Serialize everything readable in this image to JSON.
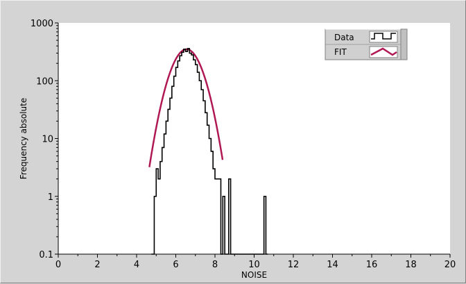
{
  "chart_data": {
    "type": "line",
    "title": "",
    "xlabel": "NOISE",
    "ylabel": "Frequency absolute",
    "xlim": [
      0,
      20
    ],
    "ylim": [
      0.1,
      1000
    ],
    "yscale": "log",
    "grid": false,
    "legend_position": "top-right",
    "x_ticks": [
      "0",
      "2",
      "4",
      "6",
      "8",
      "10",
      "12",
      "14",
      "16",
      "18",
      "20"
    ],
    "y_ticks": [
      {
        "value": 1000,
        "label": "1000"
      },
      {
        "value": 100,
        "label": "100"
      },
      {
        "value": 10,
        "label": "10"
      },
      {
        "value": 1,
        "label": "1"
      },
      {
        "value": 0.1,
        "label": "0.1"
      }
    ],
    "series": [
      {
        "name": "Data",
        "style": "step",
        "color": "#000000",
        "points": [
          [
            4.75,
            0.1
          ],
          [
            4.9,
            1
          ],
          [
            5.0,
            3
          ],
          [
            5.1,
            2
          ],
          [
            5.2,
            4
          ],
          [
            5.3,
            7
          ],
          [
            5.4,
            12
          ],
          [
            5.5,
            20
          ],
          [
            5.6,
            32
          ],
          [
            5.7,
            50
          ],
          [
            5.8,
            80
          ],
          [
            5.9,
            120
          ],
          [
            6.0,
            170
          ],
          [
            6.1,
            220
          ],
          [
            6.2,
            270
          ],
          [
            6.3,
            310
          ],
          [
            6.4,
            350
          ],
          [
            6.5,
            320
          ],
          [
            6.6,
            360
          ],
          [
            6.7,
            300
          ],
          [
            6.8,
            280
          ],
          [
            6.9,
            230
          ],
          [
            7.0,
            190
          ],
          [
            7.1,
            140
          ],
          [
            7.2,
            100
          ],
          [
            7.3,
            70
          ],
          [
            7.4,
            45
          ],
          [
            7.5,
            28
          ],
          [
            7.6,
            17
          ],
          [
            7.7,
            10
          ],
          [
            7.8,
            6
          ],
          [
            7.9,
            3
          ],
          [
            8.0,
            2
          ],
          [
            8.1,
            2
          ],
          [
            8.2,
            2
          ],
          [
            8.3,
            0.1
          ],
          [
            8.4,
            1
          ],
          [
            8.5,
            0.1
          ],
          [
            8.7,
            2
          ],
          [
            8.8,
            0.1
          ],
          [
            10.5,
            1
          ],
          [
            10.6,
            0.1
          ]
        ]
      },
      {
        "name": "FIT",
        "style": "line",
        "color": "#b01854",
        "mu": 6.55,
        "sigma": 0.62,
        "amplitude": 350,
        "x_range": [
          4.65,
          8.4
        ]
      }
    ]
  },
  "legend": {
    "items": [
      {
        "label": "Data",
        "color": "#000000",
        "icon": "step-line-icon"
      },
      {
        "label": "FIT",
        "color": "#b01854",
        "icon": "zigzag-line-icon"
      }
    ]
  }
}
